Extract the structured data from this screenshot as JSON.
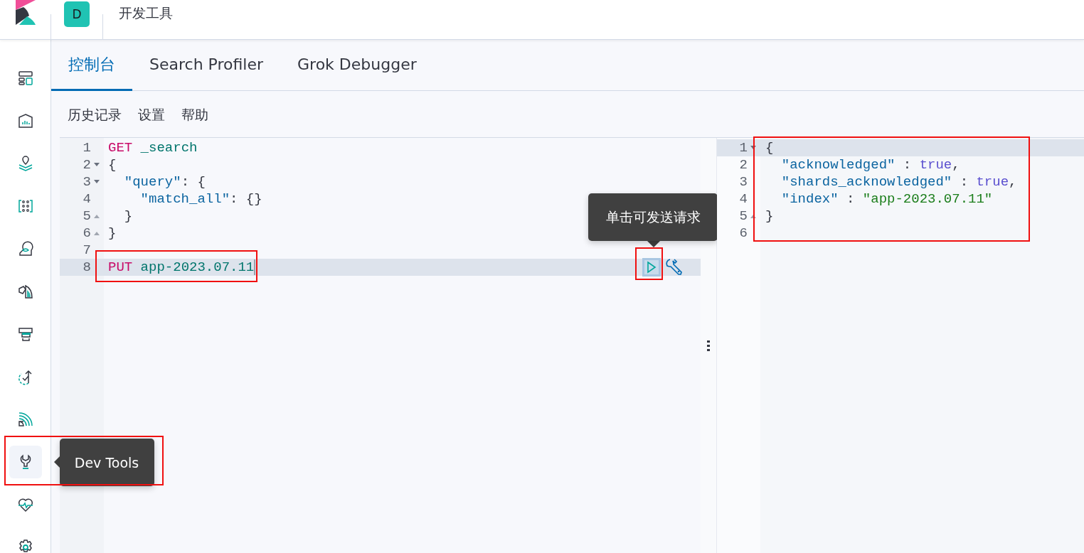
{
  "header": {
    "avatar": "D",
    "title": "开发工具"
  },
  "sidebar": {
    "items": [
      {
        "selected": false,
        "marked": false
      },
      {
        "selected": false,
        "marked": false
      },
      {
        "selected": false,
        "marked": false
      },
      {
        "selected": false,
        "marked": false
      },
      {
        "selected": false,
        "marked": false
      },
      {
        "selected": false,
        "marked": false
      },
      {
        "selected": false,
        "marked": false
      },
      {
        "selected": false,
        "marked": false
      },
      {
        "selected": false,
        "marked": false
      },
      {
        "selected": true,
        "marked": true,
        "tooltip": "Dev Tools"
      },
      {
        "selected": false,
        "marked": false
      },
      {
        "selected": false,
        "marked": false
      }
    ]
  },
  "tabs": [
    {
      "label": "控制台",
      "selected": true
    },
    {
      "label": "Search Profiler",
      "selected": false
    },
    {
      "label": "Grok Debugger",
      "selected": false
    }
  ],
  "menu": [
    "历史记录",
    "设置",
    "帮助"
  ],
  "request_editor": {
    "lines": [
      {
        "number": "1",
        "fold_start": false,
        "fold_end": false,
        "active": false,
        "marked": false,
        "tokens": [
          {
            "kind": "method",
            "text": "GET"
          },
          {
            "kind": "url",
            "text": " _search"
          }
        ]
      },
      {
        "number": "2",
        "fold_start": true,
        "fold_end": false,
        "active": false,
        "marked": false,
        "tokens": [
          {
            "kind": "punct",
            "text": "{"
          }
        ]
      },
      {
        "number": "3",
        "fold_start": true,
        "fold_end": false,
        "active": false,
        "marked": false,
        "tokens": [
          {
            "kind": "key",
            "text": "  \"query\""
          },
          {
            "kind": "punct",
            "text": ": {"
          }
        ]
      },
      {
        "number": "4",
        "fold_start": false,
        "fold_end": false,
        "active": false,
        "marked": false,
        "tokens": [
          {
            "kind": "key",
            "text": "    \"match_all\""
          },
          {
            "kind": "punct",
            "text": ": {}"
          }
        ]
      },
      {
        "number": "5",
        "fold_start": false,
        "fold_end": true,
        "active": false,
        "marked": false,
        "tokens": [
          {
            "kind": "punct",
            "text": "  }"
          }
        ]
      },
      {
        "number": "6",
        "fold_start": false,
        "fold_end": true,
        "active": false,
        "marked": false,
        "tokens": [
          {
            "kind": "punct",
            "text": "}"
          }
        ]
      },
      {
        "number": "7",
        "fold_start": false,
        "fold_end": false,
        "active": false,
        "marked": false
      },
      {
        "number": "8",
        "fold_start": false,
        "fold_end": false,
        "active": true,
        "marked": true,
        "tokens": [
          {
            "kind": "method",
            "text": "PUT"
          },
          {
            "kind": "url",
            "text": " app-2023.07.11"
          }
        ]
      }
    ],
    "run_button": {
      "focused": true,
      "marked": true
    },
    "run_tooltip": "单击可发送请求"
  },
  "response_panel": {
    "marked": true,
    "lines": [
      {
        "number": "1",
        "fold_start": true,
        "fold_end": false,
        "active": true,
        "tokens": [
          {
            "kind": "punct",
            "text": "{"
          }
        ]
      },
      {
        "number": "2",
        "fold_start": false,
        "fold_end": false,
        "active": false,
        "tokens": [
          {
            "kind": "key",
            "text": "  \"acknowledged\""
          },
          {
            "kind": "punct",
            "text": " : "
          },
          {
            "kind": "bool",
            "text": "true"
          },
          {
            "kind": "punct",
            "text": ","
          }
        ]
      },
      {
        "number": "3",
        "fold_start": false,
        "fold_end": false,
        "active": false,
        "tokens": [
          {
            "kind": "key",
            "text": "  \"shards_acknowledged\""
          },
          {
            "kind": "punct",
            "text": " : "
          },
          {
            "kind": "bool",
            "text": "true"
          },
          {
            "kind": "punct",
            "text": ","
          }
        ]
      },
      {
        "number": "4",
        "fold_start": false,
        "fold_end": false,
        "active": false,
        "tokens": [
          {
            "kind": "key",
            "text": "  \"index\""
          },
          {
            "kind": "punct",
            "text": " : "
          },
          {
            "kind": "string",
            "text": "\"app-2023.07.11\""
          }
        ]
      },
      {
        "number": "5",
        "fold_start": false,
        "fold_end": true,
        "active": false,
        "tokens": [
          {
            "kind": "punct",
            "text": "}"
          }
        ]
      },
      {
        "number": "6",
        "fold_start": false,
        "fold_end": false,
        "active": false
      }
    ]
  }
}
